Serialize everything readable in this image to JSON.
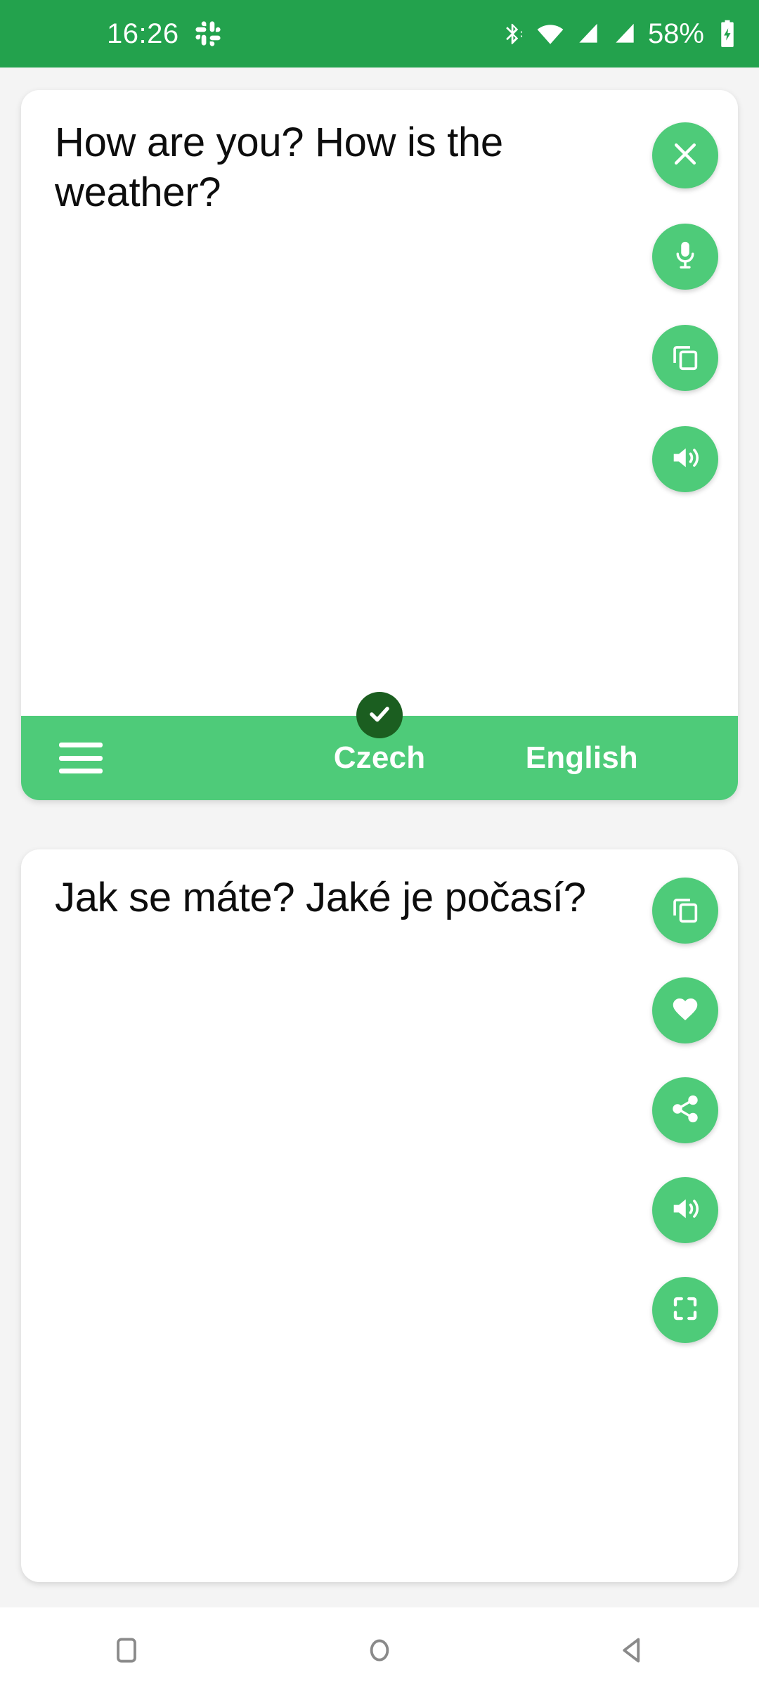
{
  "status_bar": {
    "time": "16:26",
    "battery_percent": "58%",
    "background_color": "#23a24d",
    "icons": [
      "slack-icon",
      "bluetooth-icon",
      "wifi-icon",
      "signal-1-icon",
      "signal-2-icon",
      "battery-charging-icon"
    ]
  },
  "source_card": {
    "text": "How are you? How is the weather?",
    "actions": [
      {
        "name": "close-button",
        "icon": "close-icon"
      },
      {
        "name": "microphone-button",
        "icon": "microphone-icon"
      },
      {
        "name": "copy-button",
        "icon": "copy-icon"
      },
      {
        "name": "speak-button",
        "icon": "speaker-icon"
      }
    ]
  },
  "language_bar": {
    "menu_icon": "hamburger-menu-icon",
    "source_language": "Czech",
    "target_language": "English",
    "badge_icon": "check-icon",
    "background_color": "#4ecb79",
    "badge_color": "#1b5e20"
  },
  "target_card": {
    "text": "Jak se máte? Jaké je počasí?",
    "actions": [
      {
        "name": "copy-button",
        "icon": "copy-icon"
      },
      {
        "name": "favorite-button",
        "icon": "heart-icon"
      },
      {
        "name": "share-button",
        "icon": "share-icon"
      },
      {
        "name": "speak-button",
        "icon": "speaker-icon"
      },
      {
        "name": "fullscreen-button",
        "icon": "fullscreen-icon"
      }
    ]
  },
  "nav_bar": {
    "recents_label": "recents-icon",
    "home_label": "home-icon",
    "back_label": "back-icon",
    "color": "#8a8a8a"
  },
  "accent_color": "#4ecb79"
}
